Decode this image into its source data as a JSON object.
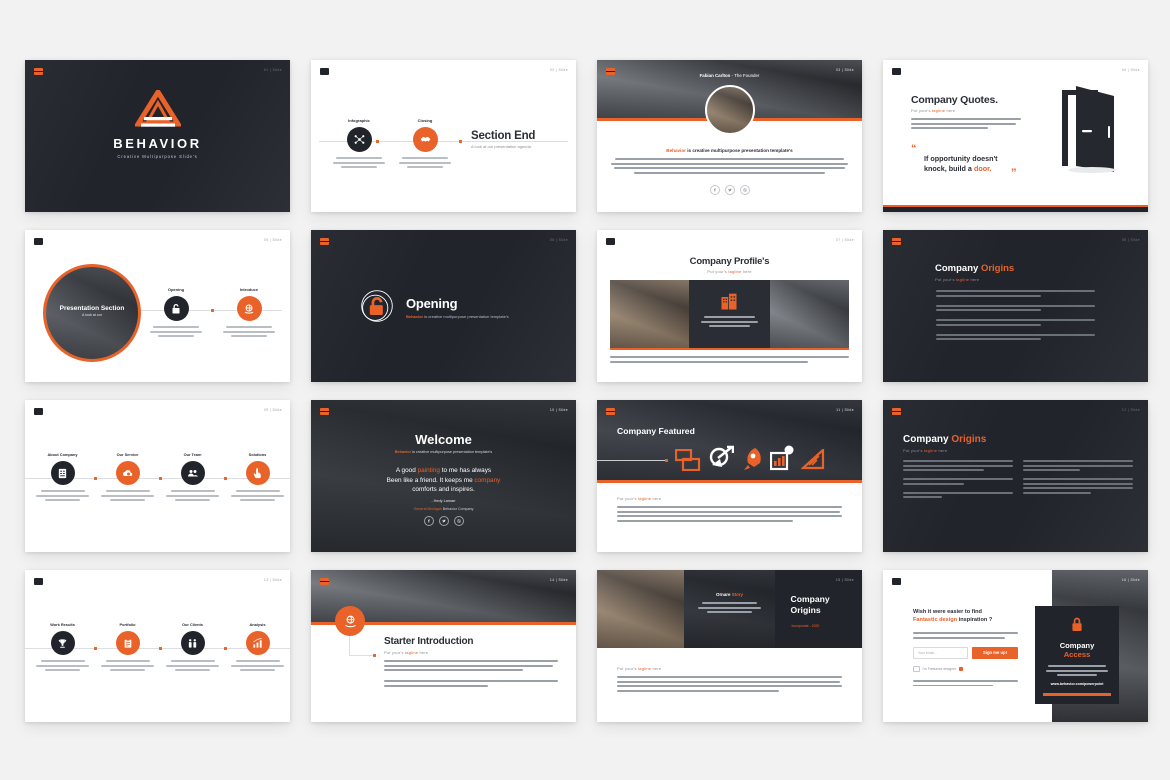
{
  "page": {
    "background": "#f2f2f2",
    "accent": "#e8622a",
    "dark": "#22242c",
    "brand": "Behavior",
    "logo_icon": "behavior-triangle-logo-icon",
    "corner_meta_prefix": "01",
    "corner_meta_label": "Slide"
  },
  "slides": [
    {
      "id": "cover",
      "theme": "dark",
      "title": "BEHAVIOR",
      "subtitle": "Creative Multipurpose Slide's",
      "logo_icon": "triangle-logo-icon",
      "meta": "01 | Slide"
    },
    {
      "id": "section-end",
      "theme": "light",
      "meta": "02 | Slide",
      "title": "Section End",
      "subtitle": "A look at our presentation agenda",
      "steps": [
        {
          "label": "Infographic",
          "icon": "network-nodes-icon",
          "style": "dark",
          "body": "Incorporamento odio metus auctor at dapibus quam aliquam sed pretium viverra"
        },
        {
          "label": "Closing",
          "icon": "handshake-icon",
          "style": "orange",
          "body": "Incorporamento odio metus auctor at dapibus quam aliquam sed pretium viverra"
        }
      ]
    },
    {
      "id": "founder-profile",
      "theme": "light",
      "meta": "03 | Slide",
      "name": "Fabian Carlton",
      "role": "The Founder",
      "headline_accent": "Behavior",
      "headline_rest": "is creative multipurpose presentation template's",
      "body": "Assumenda ets odio metus auctor at dapibus quam aliquam sed pretium consectetuer praesent turpis writes dolor elementum ipsum volutpat tincidunt dapibus integer mollis de vel magna hendrerit eleifend nulla dictum pellentesque lacus rutrum malesuada at dapibus quam dignissim.",
      "avatar": "founder-portrait",
      "socials": [
        "facebook-icon",
        "twitter-icon",
        "dribbble-icon"
      ]
    },
    {
      "id": "company-quotes",
      "theme": "light",
      "meta": "04 | Slide",
      "title": "Company Quotes.",
      "tagline_pre": "Put your's",
      "tagline_accent": "tagline",
      "tagline_post": "here",
      "body": "Assumenda ets odio metus auctor at dapibus neque aliquam sed pretium viverra ornare praesent turpis writes dolor elementum ipsum volutpat tincidunt dapibus integer mollis de vel magna hendrerit.",
      "quote_line1": "If opportunity doesn't",
      "quote_line2_pre": "knock, build a",
      "quote_line2_accent": "door.",
      "illustration": "open-door-icon"
    },
    {
      "id": "presentation-section",
      "theme": "light",
      "meta": "05 | Slide",
      "circle_title": "Presentation Section",
      "circle_sub": "A look at our",
      "steps": [
        {
          "label": "Opening",
          "icon": "padlock-open-icon",
          "style": "dark",
          "body": "Incorporamento odio metus auctor at dapibus quam aliquam sed pretium viverra"
        },
        {
          "label": "Introduce",
          "icon": "globe-hand-icon",
          "style": "orange",
          "body": "Incorporamento odio metus auctor at dapibus quam aliquam sed pretium viverra"
        }
      ]
    },
    {
      "id": "opening",
      "theme": "dark",
      "meta": "06 | Slide",
      "title": "Opening",
      "sub_accent": "Behavior",
      "sub_rest": "is creative multipurpose presentation template's",
      "icon": "padlock-open-icon"
    },
    {
      "id": "company-profiles",
      "theme": "light",
      "meta": "07 | Slide",
      "title": "Company Profile's",
      "tagline_pre": "Put your's",
      "tagline_accent": "tagline",
      "tagline_post": "here",
      "card_icon": "buildings-icon",
      "card_body": "Incorporamento odio metus auctor at dapibus quam aliquam sed pretium viverra",
      "body": "Assumenda ets odio metus auctor at dapibus quam aliquam sed pretium viverra turpis praesent turpis writes dolor elementum ipsum volutpat tincidunt dapibus integer mollis de vel magna hendrerit eleifend nulla dictum pellentesque lacus rutrum malesuada.",
      "photos": [
        "team-sofa-photo",
        "team-meeting-photo"
      ]
    },
    {
      "id": "company-origins-list",
      "theme": "dark",
      "meta": "08 | Slide",
      "title_pre": "Company",
      "title_accent": "Origins",
      "tagline_pre": "Put your's",
      "tagline_accent": "tagline",
      "tagline_post": "here",
      "items": [
        "1.  Assumenda ets odio metus auctor at dapibus quam aliquam sed pretium viverra ornare praesent turpis writes dolor elementum ipsum volutpat tincidunt dapibus integer",
        "2.  Assumenda ets odio metus auctor at dapibus quam aliquam sed pretium viverra ornare praesent turpis writes dolor elementum ipsum volutpat tincidunt dapibus integer",
        "3.  Assumenda ets odio metus auctor at dapibus quam aliquam sed pretium viverra ornare praesent turpis writes dolor elementum ipsum volutpat tincidunt dapibus integer",
        "4.  Assumenda ets odio metus auctor at dapibus quam aliquam sed pretium viverra ornare praesent turpis writes dolor elementum ipsum volutpat tincidunt dapibus integer"
      ]
    },
    {
      "id": "about-timeline",
      "theme": "light",
      "meta": "09 | Slide",
      "steps": [
        {
          "label": "About Company",
          "icon": "document-list-icon",
          "style": "dark",
          "body": "Incorporamento odio metus auctor at dapibus quam aliquam sed pretium viverra"
        },
        {
          "label": "Our Service",
          "icon": "gear-cloud-icon",
          "style": "orange",
          "body": "Incorporamento odio metus auctor at dapibus quam aliquam sed pretium viverra"
        },
        {
          "label": "Our Team",
          "icon": "people-group-icon",
          "style": "dark",
          "body": "Incorporamento odio metus auctor at dapibus quam aliquam sed pretium viverra"
        },
        {
          "label": "Solutions",
          "icon": "hand-pointer-icon",
          "style": "orange",
          "body": "Incorporamento odio metus auctor at dapibus quam aliquam sed pretium viverra"
        }
      ]
    },
    {
      "id": "welcome",
      "theme": "photo",
      "meta": "10 | Slide",
      "title": "Welcome",
      "sub_accent": "Behavior",
      "sub_rest": "is creative multipurpose presentation template's",
      "quote_l1_a": "A good",
      "quote_l1_accent": "painting",
      "quote_l1_b": "to me has always",
      "quote_l2_a": "Been like a friend. It keeps me",
      "quote_l2_accent": "company",
      "quote_l3": "comforts and inspires.",
      "author": "- Hedy Lamarr",
      "credit_accent": "General Michigan",
      "credit_rest": "Behavior Company",
      "socials": [
        "facebook-icon",
        "twitter-icon",
        "dribbble-icon"
      ]
    },
    {
      "id": "company-featured",
      "theme": "photo",
      "meta": "11 | Slide",
      "title": "Company Featured",
      "icons": [
        "windows-icon",
        "target-arrow-icon",
        "rocket-icon",
        "bar-chart-icon",
        "ruler-triangle-icon"
      ],
      "tagline_pre": "Put your's",
      "tagline_accent": "tagline",
      "tagline_post": "here",
      "body": "Assumenda ets odio metus auctor at dapibus quam aliquam sed pretium viverra ornare praesent turpis writes dolor elementum ipsum volutpat tincidunt dapibus integer mollis de vel magna hendrerit eleifend nulla dictum pellentesque lacus rutrum malesuada at dapibus quam dignissim sed pretium ornare praesent turpis writes dolor elementum dapibus quam aliquam sed pretium ornare ornare."
    },
    {
      "id": "company-origins-columns",
      "theme": "dark",
      "meta": "12 | Slide",
      "title_pre": "Company",
      "title_accent": "Origins",
      "tagline_pre": "Put your's",
      "tagline_accent": "tagline",
      "tagline_post": "here",
      "columns": [
        [
          "Assumenda ets odio metus auctor at dapibus quam aliquam sed pretium ornare praesent turpis writes dolor elementum ipsum volutpat tincidunt dapibus integer mollis de vel magna hendrerit eleifend nulla dictum pellentesque lacus rutrum malesuada.",
          "Assumenda ets odio metus auctor at dapibus quam aliquam sed pretium ornare praesent turpis writes dolor elementum.",
          "Assumenda ets odio metus auctor at dapibus quam aliquam sed pretium ornare praesent."
        ],
        [
          "Assumenda ets odio metus auctor at dapibus quam aliquam sed pretium ornare praesent turpis writes dolor elementum ipsum volutpat tincidunt dapibus integer mollis de vel magna hendrerit eleifend nulla dictum pellentesque lacus.",
          "Assumenda ets odio metus auctor at dapibus quam aliquam sed pretium ornare praesent turpis writes dolor elementum ipsum volutpat tincidunt dapibus integer mollis de vel magna hendrerit eleifend nulla dictum pellentesque lacus ornare praesent turpis writes dolor aliquam ut elementum ipsum."
        ]
      ]
    },
    {
      "id": "work-timeline",
      "theme": "light",
      "meta": "13 | Slide",
      "steps": [
        {
          "label": "Work Results",
          "icon": "trophy-icon",
          "style": "dark",
          "body": "Incorporamento odio metus auctor at dapibus quam aliquam sed pretium viverra"
        },
        {
          "label": "Portfolio",
          "icon": "clipboard-icon",
          "style": "orange",
          "body": "Incorporamento odio metus auctor at dapibus quam aliquam sed pretium viverra"
        },
        {
          "label": "Our Clients",
          "icon": "people-pair-icon",
          "style": "dark",
          "body": "Incorporamento odio metus auctor at dapibus quam aliquam sed pretium viverra"
        },
        {
          "label": "Analysis",
          "icon": "growth-chart-icon",
          "style": "orange",
          "body": "Incorporamento odio metus auctor at dapibus quam aliquam sed pretium viverra"
        }
      ]
    },
    {
      "id": "starter-introduction",
      "theme": "light",
      "meta": "14 | Slide",
      "title": "Starter Introduction",
      "tagline_pre": "Put your's",
      "tagline_accent": "tagline",
      "tagline_post": "here",
      "badge_icon": "globe-hand-icon",
      "body1": "Assumenda ets odio metus auctor at dapibus quam aliquam sed pretium ornare ornare praesent turpis writes dolor elementum ipsum volutpat tincidunt dapibus integer mollis de vel magna hendrerit eleifend nulla dictum pellentesque lacus rutrum malesuada.",
      "body2": "Assumenda ets odio metus auctor at dapibus quam aliquam sed pretium ornare praesent turpis writes dolor elementum ipsum volutpat tincidunt."
    },
    {
      "id": "company-origins-gallery",
      "theme": "light",
      "meta": "15 | Slide",
      "title_l1": "Company",
      "title_l2": "Origins",
      "title_sub": "Incorporate - 2020",
      "card_title_pre": "Ornare",
      "card_title_accent": "Story",
      "card_body": "Incorporamento odio metus auctor at dapibus quam aliquam sed pretium viverra",
      "body_tagline_pre": "Put your's",
      "body_tagline_accent": "tagline",
      "body_tagline_post": "here",
      "body": "Assumenda ets odio metus auctor at dapibus quam aliquam sed pretium ornare ornare praesent turpis writes dolor elementum ipsum volutpat tincidunt dapibus integer mollis de vel magna hendrerit eleifend nulla dictum pellentesque lacus rutrum malesuada at dapibus quam dignissim sed pretium ornare aliquam praesent lacus ornare dolor elementum dapibus quam aliquam sed pretium ornare ornare.",
      "photos": [
        "team-sofa-photo",
        "meeting-table-photo"
      ]
    },
    {
      "id": "company-access",
      "theme": "light",
      "meta": "16 | Slide",
      "headline_l1": "Wish it were easier to find",
      "headline_l2_accent": "Fantastic design",
      "headline_l2_rest": "inspiration ?",
      "body": "Win out cheap goods, great exclusive email newsletter filled with ideas, trends, tips and the resources of online behavior on your inbox.",
      "input_placeholder": "Your email...",
      "button_label": "Sign me up!",
      "checkbox_label": "I'm Freelance designer",
      "footnote": "30 designs are already using this tool. Join Today. Don't worry we never share your email address, read our terms, view website and privacy policy our resources.",
      "card_title_l1": "Company",
      "card_title_l2": "Access",
      "card_body": "Assumenda ets odio metus auctor at dapibus quam odio aliquam sed pretium viverra ornare praesent turpis",
      "card_link": "www.behavior.com/powerpoint",
      "card_icon": "padlock-closed-icon"
    }
  ]
}
